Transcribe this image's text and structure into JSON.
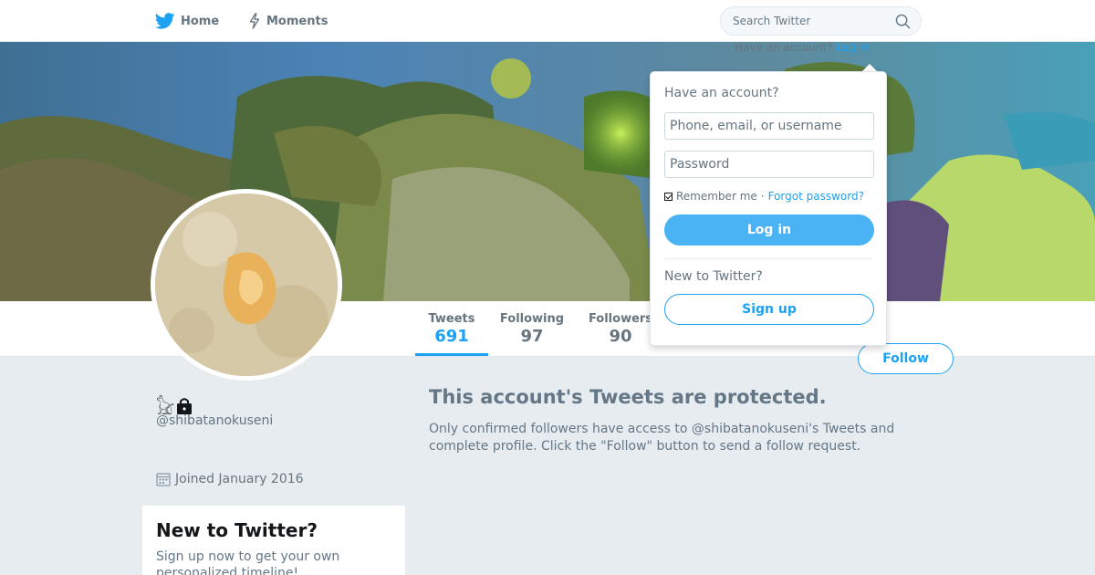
{
  "nav": {
    "home_label": "Home",
    "moments_label": "Moments",
    "search_placeholder": "Search Twitter",
    "hint_prefix": "Have an account?",
    "hint_link": "Log in"
  },
  "profile": {
    "display_name": "𓃠",
    "handle": "@shibatanokuseni",
    "joined": "Joined January 2016"
  },
  "stats": [
    {
      "label": "Tweets",
      "value": "691"
    },
    {
      "label": "Following",
      "value": "97"
    },
    {
      "label": "Followers",
      "value": "90"
    }
  ],
  "follow_label": "Follow",
  "protected": {
    "title": "This account's Tweets are protected.",
    "text": "Only confirmed followers have access to @shibatanokuseni's Tweets and complete profile. Click the \"Follow\" button to send a follow request."
  },
  "signup_card": {
    "title": "New to Twitter?",
    "text": "Sign up now to get your own personalized timeline!"
  },
  "login_dropdown": {
    "heading": "Have an account?",
    "username_placeholder": "Phone, email, or username",
    "password_placeholder": "Password",
    "remember_label": "Remember me",
    "separator": "·",
    "forgot_label": "Forgot password?",
    "login_button": "Log in",
    "new_label": "New to Twitter?",
    "signup_button": "Sign up"
  },
  "colors": {
    "accent": "#1da1f2",
    "page_bg": "#e6ecf0",
    "muted_text": "#657786"
  }
}
